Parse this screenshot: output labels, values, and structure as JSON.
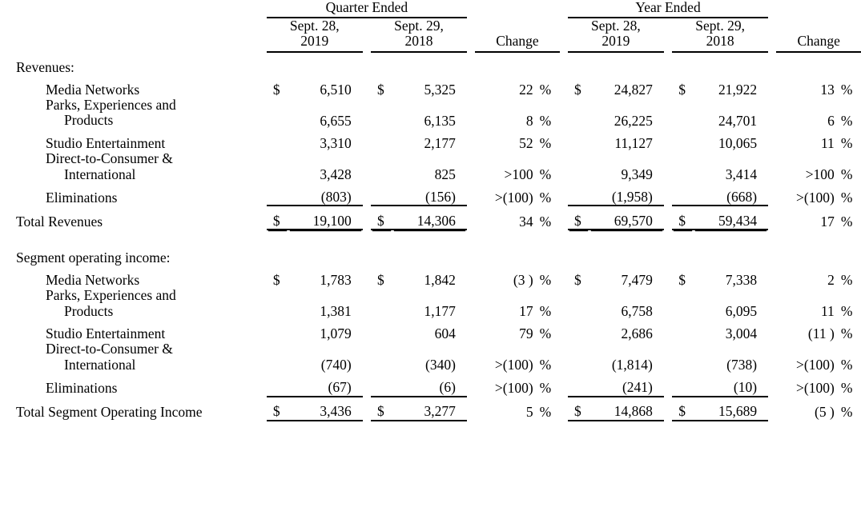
{
  "header": {
    "groups": [
      {
        "title": "Quarter Ended"
      },
      {
        "title": "Year Ended"
      }
    ],
    "quarter": {
      "col1_line1": "Sept. 28,",
      "col1_line2": "2019",
      "col2_line1": "Sept. 29,",
      "col2_line2": "2018",
      "change": "Change"
    },
    "year": {
      "col1_line1": "Sept. 28,",
      "col1_line2": "2019",
      "col2_line1": "Sept. 29,",
      "col2_line2": "2018",
      "change": "Change"
    }
  },
  "sections": [
    {
      "heading": "Revenues:",
      "rows": [
        {
          "label": "Media Networks",
          "q1_cur": "$",
          "q1": "6,510",
          "q2_cur": "$",
          "q2": "5,325",
          "q_chg": "22",
          "q_pct": "%",
          "y1_cur": "$",
          "y1": "24,827",
          "y2_cur": "$",
          "y2": "21,922",
          "y_chg": "13",
          "y_pct": "%"
        },
        {
          "label_line1": "Parks, Experiences and",
          "label_line2": "Products",
          "q1_cur": "",
          "q1": "6,655",
          "q2_cur": "",
          "q2": "6,135",
          "q_chg": "8",
          "q_pct": "%",
          "y1_cur": "",
          "y1": "26,225",
          "y2_cur": "",
          "y2": "24,701",
          "y_chg": "6",
          "y_pct": "%"
        },
        {
          "label": "Studio Entertainment",
          "q1_cur": "",
          "q1": "3,310",
          "q2_cur": "",
          "q2": "2,177",
          "q_chg": "52",
          "q_pct": "%",
          "y1_cur": "",
          "y1": "11,127",
          "y2_cur": "",
          "y2": "10,065",
          "y_chg": "11",
          "y_pct": "%"
        },
        {
          "label_line1": "Direct-to-Consumer &",
          "label_line2": "International",
          "q1_cur": "",
          "q1": "3,428",
          "q2_cur": "",
          "q2": "825",
          "q_chg": ">100",
          "q_pct": "%",
          "y1_cur": "",
          "y1": "9,349",
          "y2_cur": "",
          "y2": "3,414",
          "y_chg": ">100",
          "y_pct": "%"
        },
        {
          "label": "Eliminations",
          "q1_cur": "",
          "q1": "(803)",
          "q2_cur": "",
          "q2": "(156)",
          "q_chg": ">(100)",
          "q_pct": "%",
          "y1_cur": "",
          "y1": "(1,958)",
          "y2_cur": "",
          "y2": "(668)",
          "y_chg": ">(100)",
          "y_pct": "%"
        }
      ],
      "total": {
        "label": "Total Revenues",
        "q1_cur": "$",
        "q1": "19,100",
        "q2_cur": "$",
        "q2": "14,306",
        "q_chg": "34",
        "q_pct": "%",
        "y1_cur": "$",
        "y1": "69,570",
        "y2_cur": "$",
        "y2": "59,434",
        "y_chg": "17",
        "y_pct": "%"
      }
    },
    {
      "heading": "Segment operating income:",
      "rows": [
        {
          "label": "Media Networks",
          "q1_cur": "$",
          "q1": "1,783",
          "q2_cur": "$",
          "q2": "1,842",
          "q_chg": "(3 )",
          "q_pct": "%",
          "y1_cur": "$",
          "y1": "7,479",
          "y2_cur": "$",
          "y2": "7,338",
          "y_chg": "2",
          "y_pct": "%"
        },
        {
          "label_line1": "Parks, Experiences and",
          "label_line2": "Products",
          "q1_cur": "",
          "q1": "1,381",
          "q2_cur": "",
          "q2": "1,177",
          "q_chg": "17",
          "q_pct": "%",
          "y1_cur": "",
          "y1": "6,758",
          "y2_cur": "",
          "y2": "6,095",
          "y_chg": "11",
          "y_pct": "%"
        },
        {
          "label": "Studio Entertainment",
          "q1_cur": "",
          "q1": "1,079",
          "q2_cur": "",
          "q2": "604",
          "q_chg": "79",
          "q_pct": "%",
          "y1_cur": "",
          "y1": "2,686",
          "y2_cur": "",
          "y2": "3,004",
          "y_chg": "(11 )",
          "y_pct": "%"
        },
        {
          "label_line1": "Direct-to-Consumer &",
          "label_line2": "International",
          "q1_cur": "",
          "q1": "(740)",
          "q2_cur": "",
          "q2": "(340)",
          "q_chg": ">(100)",
          "q_pct": "%",
          "y1_cur": "",
          "y1": "(1,814)",
          "y2_cur": "",
          "y2": "(738)",
          "y_chg": ">(100)",
          "y_pct": "%"
        },
        {
          "label": "Eliminations",
          "q1_cur": "",
          "q1": "(67)",
          "q2_cur": "",
          "q2": "(6)",
          "q_chg": ">(100)",
          "q_pct": "%",
          "y1_cur": "",
          "y1": "(241)",
          "y2_cur": "",
          "y2": "(10)",
          "y_chg": ">(100)",
          "y_pct": "%"
        }
      ],
      "total": {
        "label": "Total Segment Operating Income",
        "q1_cur": "$",
        "q1": "3,436",
        "q2_cur": "$",
        "q2": "3,277",
        "q_chg": "5",
        "q_pct": "%",
        "y1_cur": "$",
        "y1": "14,868",
        "y2_cur": "$",
        "y2": "15,689",
        "y_chg": "(5 )",
        "y_pct": "%"
      }
    }
  ]
}
